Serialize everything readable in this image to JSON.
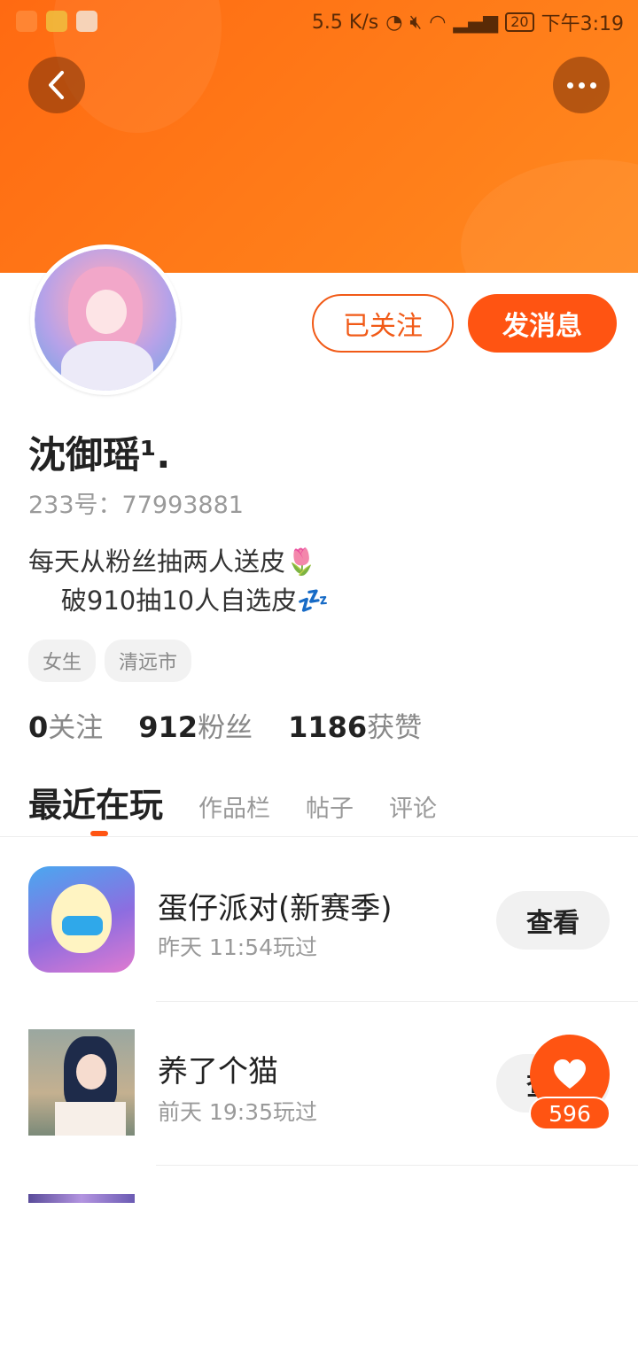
{
  "status_bar": {
    "speed": "5.5 K/s",
    "battery": "20",
    "time": "下午3:19"
  },
  "profile": {
    "username": "沈御瑶¹.",
    "id_line": "233号：77993881",
    "bio": "每天从粉丝抽两人送皮🌷\n    破910抽10人自选皮💤",
    "tags": [
      "女生",
      "清远市"
    ],
    "followed_label": "已关注",
    "message_label": "发消息"
  },
  "stats": [
    {
      "num": "0",
      "label": "关注"
    },
    {
      "num": "912",
      "label": "粉丝"
    },
    {
      "num": "1186",
      "label": "获赞"
    }
  ],
  "tabs": [
    "最近在玩",
    "作品栏",
    "帖子",
    "评论"
  ],
  "games": [
    {
      "title": "蛋仔派对(新赛季)",
      "time": "昨天 11:54玩过",
      "button": "查看"
    },
    {
      "title": "养了个猫",
      "time": "前天 19:35玩过",
      "button": "查看"
    }
  ],
  "like": {
    "count": "596"
  },
  "colors": {
    "accent": "#ff5412",
    "banner": "#ff7a18"
  }
}
